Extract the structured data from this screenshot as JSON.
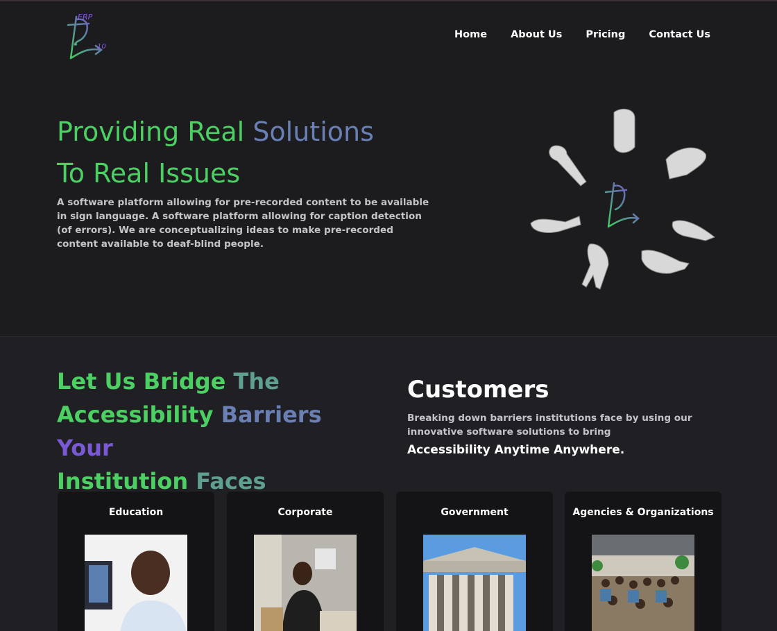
{
  "logo": {
    "text_top": "ERP",
    "text_side": "10"
  },
  "nav": {
    "items": [
      "Home",
      "About Us",
      "Pricing",
      "Contact Us"
    ]
  },
  "hero": {
    "title_line1_a": "Providing Real ",
    "title_line1_b": "Solutions",
    "title_line2": "To Real Issues",
    "description": "A software platform allowing for pre-recorded content to be available in sign language. A software platform allowing for caption detection (of errors). We are conceptualizing ideas to make pre-recorded content available to deaf-blind people."
  },
  "bridge": {
    "w1": "Let Us Bridge ",
    "w2": "The",
    "w3": "Accessibility ",
    "w4": "Barriers ",
    "w5": "Your",
    "w6": "Institution ",
    "w7": "Faces"
  },
  "customers": {
    "title": "Customers",
    "description": "Breaking down barriers institutions face by using our innovative software solutions to bring",
    "tagline": "Accessibility Anytime Anywhere."
  },
  "cards": [
    {
      "title": "Education"
    },
    {
      "title": "Corporate"
    },
    {
      "title": "Government"
    },
    {
      "title": "Agencies & Organizations"
    }
  ]
}
